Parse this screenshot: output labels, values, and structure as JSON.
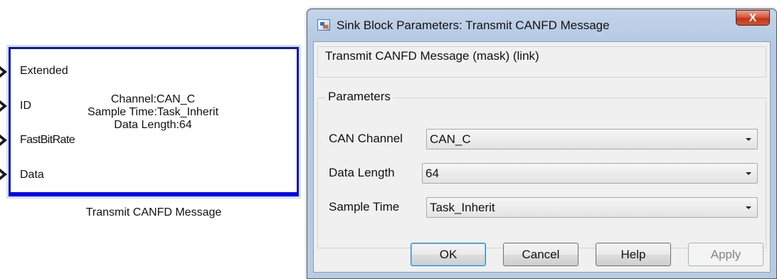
{
  "block": {
    "ports": [
      "Extended",
      "ID",
      "FastBitRate",
      "Data"
    ],
    "center_lines": [
      "Channel:CAN_C",
      "Sample Time:Task_Inherit",
      "Data Length:64"
    ],
    "caption": "Transmit CANFD Message",
    "border_color": "#0a1aa8"
  },
  "dialog": {
    "title": "Sink Block Parameters: Transmit CANFD Message",
    "close_label": "X",
    "description": "Transmit CANFD Message (mask) (link)",
    "parameters_legend": "Parameters",
    "params": [
      {
        "label": "CAN Channel",
        "value": "CAN_C"
      },
      {
        "label": "Data Length",
        "value": "64"
      },
      {
        "label": "Sample Time",
        "value": "Task_Inherit"
      }
    ],
    "buttons": {
      "ok": "OK",
      "cancel": "Cancel",
      "help": "Help",
      "apply": "Apply"
    },
    "apply_enabled": false,
    "icons": {
      "app": "simulink-block-icon",
      "close": "close-icon",
      "dropdown": "chevron-down-icon"
    },
    "colors": {
      "close": "#c94b2b",
      "titlebar": "#b9cde6",
      "default_button_border": "#3c7fb1"
    }
  }
}
